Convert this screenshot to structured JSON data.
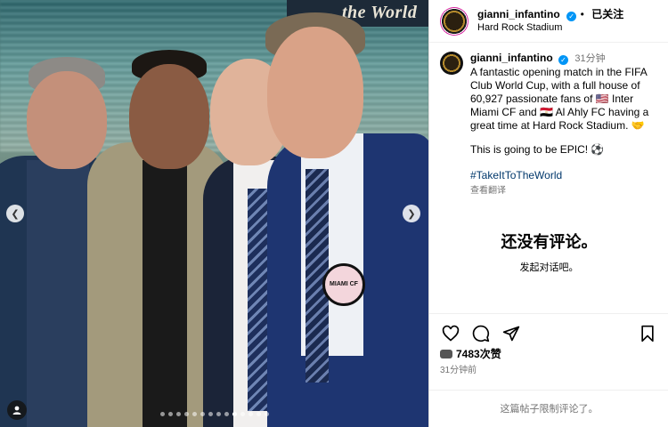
{
  "photo": {
    "banner_text": "the World",
    "crest_text": "MIAMI CF",
    "carousel": {
      "total_slides": 14,
      "active_index": 9
    }
  },
  "header": {
    "username": "gianni_infantino",
    "follow_label": "已关注",
    "location": "Hard Rock Stadium"
  },
  "caption": {
    "username": "gianni_infantino",
    "time": "31分钟",
    "text": "A fantastic opening match in the FIFA Club World Cup, with a full house of 60,927 passionate fans of 🇺🇸 Inter Miami CF and 🇪🇬 Al Ahly FC having a great time at Hard Rock Stadium. 🤝",
    "text2": "This is going to be EPIC! ⚽",
    "hashtag": "#TakeItToTheWorld",
    "translate_label": "查看翻译"
  },
  "comments": {
    "empty_title": "还没有评论。",
    "empty_sub": "发起对话吧。"
  },
  "stats": {
    "views": "7483次赞",
    "posted_ago": "31分钟前"
  },
  "footer": {
    "limited_label": "这篇帖子限制评论了。"
  },
  "colors": {
    "verified": "#0095f6",
    "hashtag": "#00376b",
    "secondary_text": "#737373"
  }
}
